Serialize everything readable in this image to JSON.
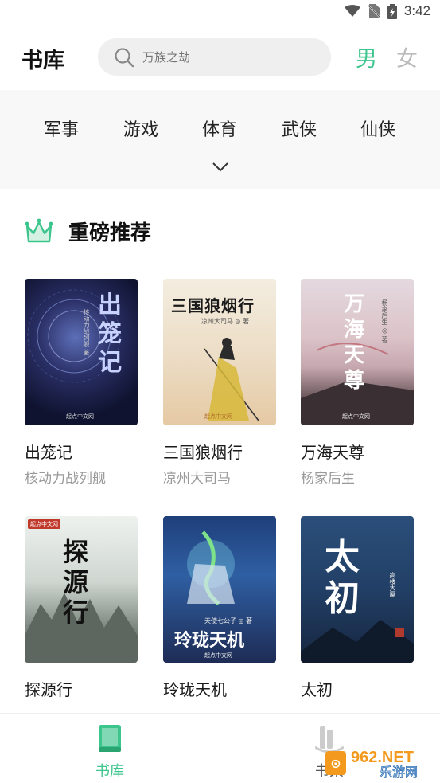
{
  "status_bar": {
    "time": "3:42"
  },
  "header": {
    "title": "书库",
    "search_placeholder": "万族之劫",
    "gender_male": "男",
    "gender_female": "女"
  },
  "categories": {
    "items": [
      "军事",
      "游戏",
      "体育",
      "武侠",
      "仙侠"
    ]
  },
  "section": {
    "title": "重磅推荐"
  },
  "books": [
    {
      "title": "出笼记",
      "author": "核动力战列舰",
      "cover_text": "出笼记",
      "cover_sub": "核动力战列舰 著"
    },
    {
      "title": "三国狼烟行",
      "author": "凉州大司马",
      "cover_text": "三国狼烟行",
      "cover_sub": "凉州大司马 ◎ 著"
    },
    {
      "title": "万海天尊",
      "author": "杨家后生",
      "cover_text": "万海天尊",
      "cover_sub": "杨家后生 ◎ 著"
    },
    {
      "title": "探源行",
      "author": "",
      "cover_text": "探源行",
      "cover_sub": ""
    },
    {
      "title": "玲珑天机",
      "author": "",
      "cover_text": "玲珑天机",
      "cover_sub": "天使七公子 ◎ 著"
    },
    {
      "title": "太初",
      "author": "",
      "cover_text": "太初",
      "cover_sub": "高楼大厦"
    }
  ],
  "cover_publisher": "起点中文网",
  "bottom_nav": {
    "library": "书库",
    "shelf": "书架"
  },
  "watermark": {
    "top": "962.NET",
    "bottom": "乐游网"
  },
  "colors": {
    "accent": "#3cc58c",
    "accent_light": "#d4f1e4"
  }
}
